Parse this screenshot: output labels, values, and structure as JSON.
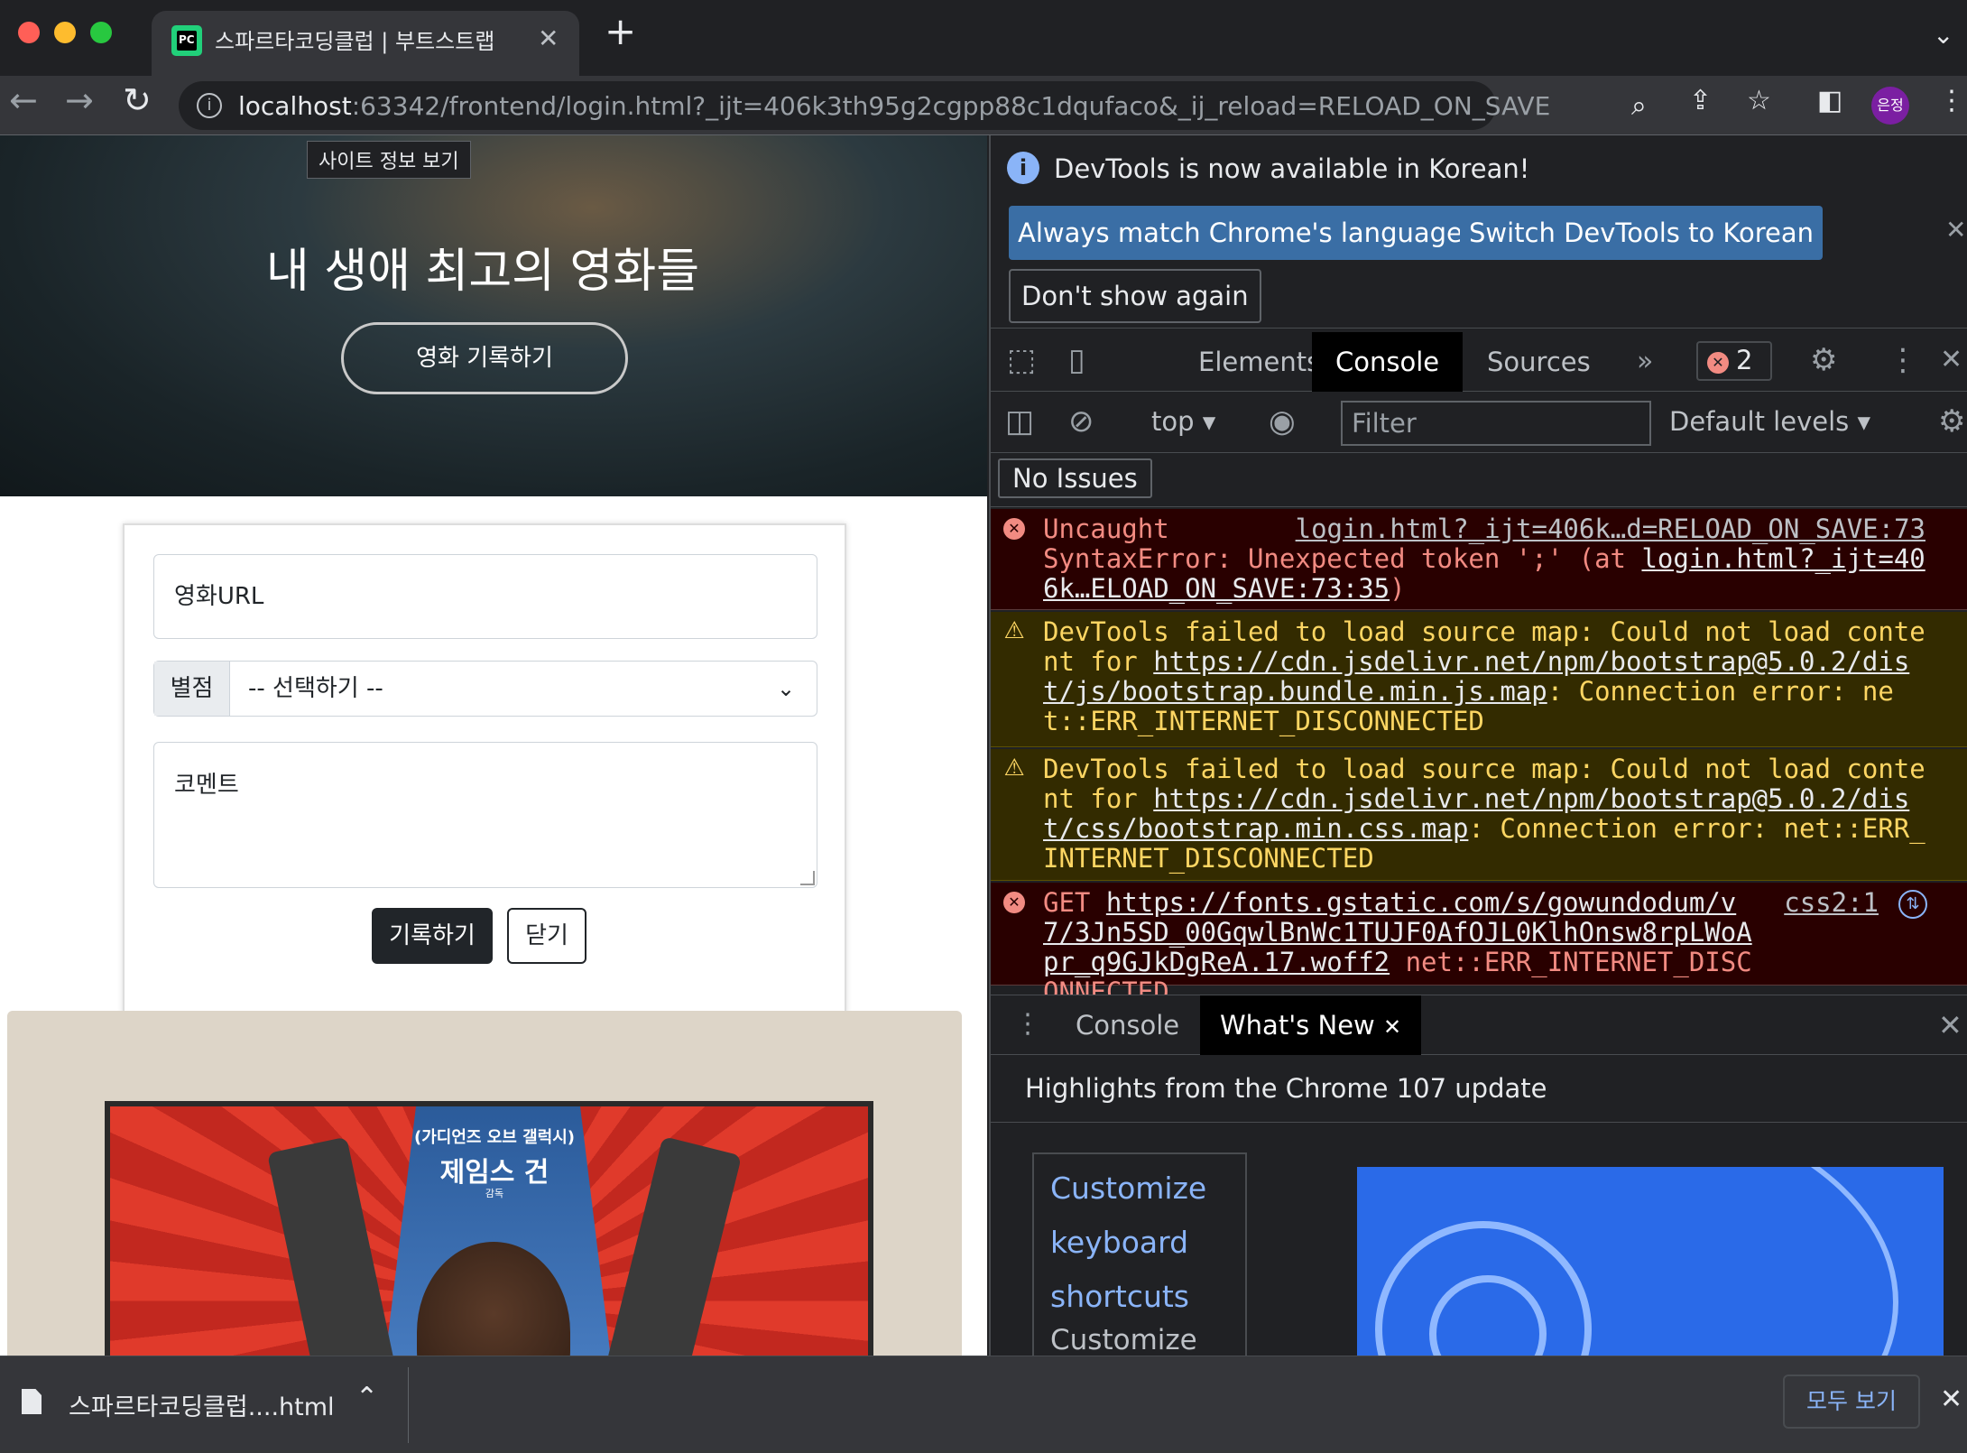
{
  "window": {
    "tab_title": "스파르타코딩클럽 | 부트스트랩 연습하기",
    "tab_favicon_text": "PC",
    "tooltip": "사이트 정보 보기",
    "url_host": "localhost",
    "url_rest": ":63342/frontend/login.html?_ijt=406k3th95g2cgpp88c1dqufaco&_ij_reload=RELOAD_ON_SAVE",
    "profile_label": "은정",
    "icons": {
      "back": "←",
      "forward": "→",
      "reload": "↻",
      "close": "✕",
      "new_tab": "+",
      "chevron": "⌄"
    }
  },
  "page": {
    "hero_title": "내 생애 최고의 영화들",
    "hero_button": "영화 기록하기",
    "form": {
      "url_placeholder": "영화URL",
      "rating_label": "별점",
      "rating_selected": "-- 선택하기 --",
      "comment_placeholder": "코멘트",
      "save_button": "기록하기",
      "close_button": "닫기"
    },
    "poster": {
      "subtitle": "(가디언즈 오브 갤럭시)",
      "title": "제임스 건",
      "credit": "감독"
    }
  },
  "devtools": {
    "infobar": {
      "message": "DevTools is now available in Korean!",
      "btn_match": "Always match Chrome's language",
      "btn_switch": "Switch DevTools to Korean",
      "btn_dont_show": "Don't show again"
    },
    "tabs": [
      "Elements",
      "Console",
      "Sources"
    ],
    "active_tab": "Console",
    "error_count": "2",
    "console": {
      "context": "top",
      "filter_placeholder": "Filter",
      "levels": "Default levels",
      "issues": "No Issues"
    },
    "messages": [
      {
        "level": "error",
        "source": "login.html?_ijt=406k…d=RELOAD_ON_SAVE:73",
        "text": "Uncaught\nSyntaxError: Unexpected token ';' (at ",
        "link": "login.html?_ijt=406k…ELOAD_ON_SAVE:73:35",
        "tail": ")"
      },
      {
        "level": "warning",
        "text": "DevTools failed to load source map: Could not load content for ",
        "link": "https://cdn.jsdelivr.net/npm/bootstrap@5.0.2/dist/js/bootstrap.bundle.min.js.map",
        "tail": ": Connection error: net::ERR_INTERNET_DISCONNECTED"
      },
      {
        "level": "warning",
        "text": "DevTools failed to load source map: Could not load content for ",
        "link": "https://cdn.jsdelivr.net/npm/bootstrap@5.0.2/dist/css/bootstrap.min.css.map",
        "tail": ": Connection error: net::ERR_INTERNET_DISCONNECTED"
      },
      {
        "level": "error",
        "source": "css2:1",
        "text": "GET ",
        "link": "https://fonts.gstatic.com/s/gowundodum/v7/3Jn5SD_00GqwlBnWc1TUJF0AfOJL0KlhOnsw8rpLWoApr_q9GJkDgReA.17.woff2",
        "tail": " net::ERR_INTERNET_DISCONNECTED"
      }
    ],
    "drawer": {
      "tabs": [
        "Console",
        "What's New"
      ],
      "active_tab": "What's New",
      "highlights": "Highlights from the Chrome 107 update",
      "links": [
        "Customize",
        "keyboard",
        "shortcuts"
      ],
      "body_text": "Customize keyboard"
    }
  },
  "downloads": {
    "file_name": "스파르타코딩클럽....html",
    "show_all": "모두 보기"
  }
}
